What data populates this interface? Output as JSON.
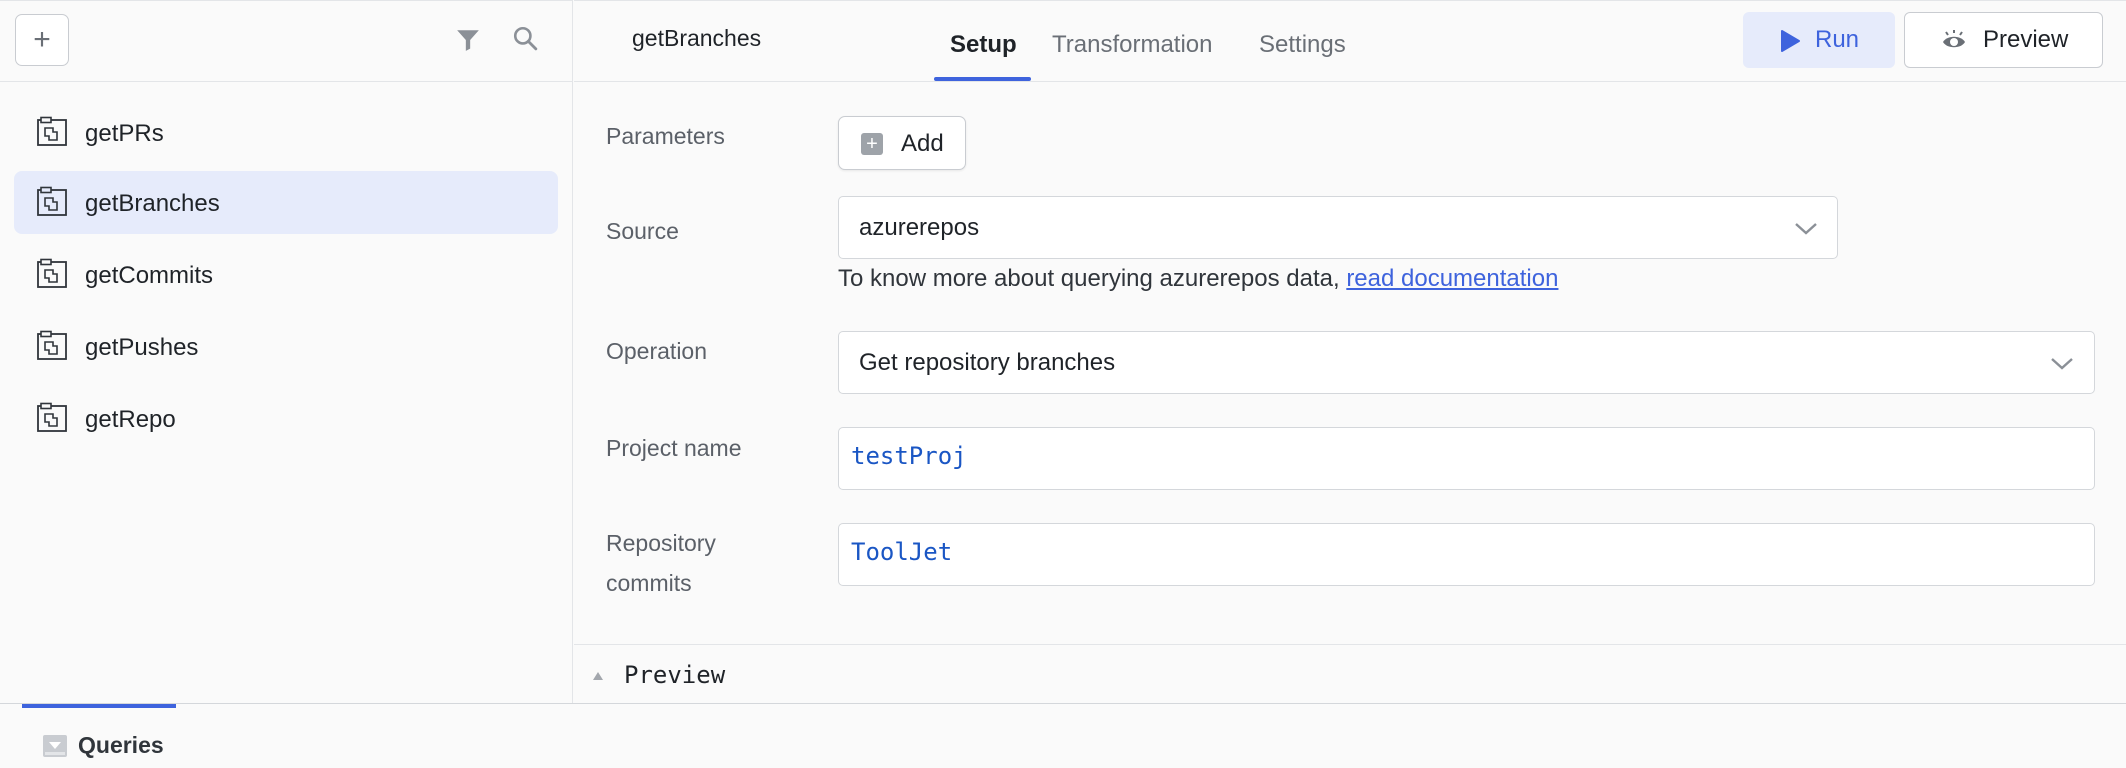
{
  "sidebar": {
    "add_button_symbol": "+",
    "icons": {
      "filter": "filter-icon",
      "search": "search-icon"
    },
    "queries": [
      {
        "label": "getPRs",
        "active": false
      },
      {
        "label": "getBranches",
        "active": true
      },
      {
        "label": "getCommits",
        "active": false
      },
      {
        "label": "getPushes",
        "active": false
      },
      {
        "label": "getRepo",
        "active": false
      }
    ]
  },
  "header": {
    "query_name": "getBranches",
    "tabs": [
      {
        "label": "Setup",
        "active": true
      },
      {
        "label": "Transformation",
        "active": false
      },
      {
        "label": "Settings",
        "active": false
      }
    ],
    "run_label": "Run",
    "preview_label": "Preview"
  },
  "form": {
    "parameters": {
      "label": "Parameters",
      "add_label": "Add"
    },
    "source": {
      "label": "Source",
      "value": "azurerepos",
      "help_prefix": "To know more about querying azurerepos data, ",
      "help_link": "read documentation"
    },
    "operation": {
      "label": "Operation",
      "value": "Get repository branches"
    },
    "project_name": {
      "label": "Project name",
      "value": "testProj"
    },
    "repository": {
      "label_line1": "Repository",
      "label_line2": "commits",
      "value": "ToolJet"
    }
  },
  "preview_panel": {
    "label": "Preview"
  },
  "bottom": {
    "queries_tab_label": "Queries"
  },
  "colors": {
    "accent": "#3e63dd",
    "active_bg": "#e6ebfb",
    "code_text": "#1a56c4"
  }
}
